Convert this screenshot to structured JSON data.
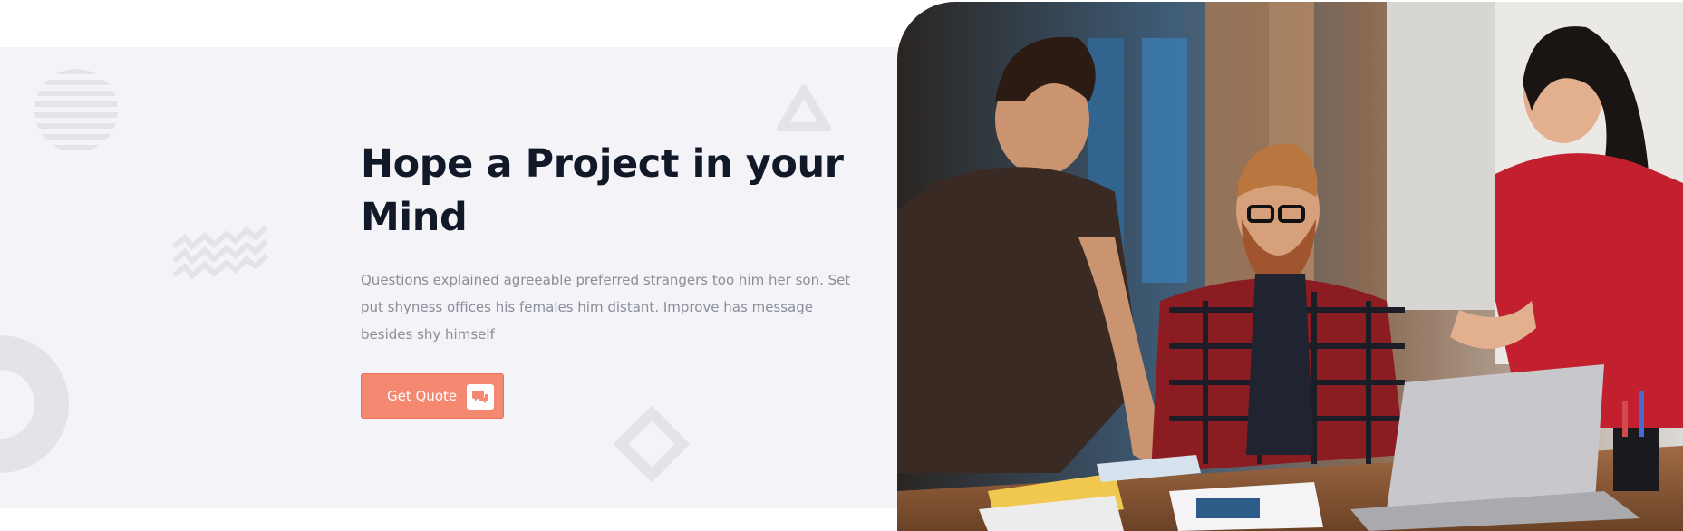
{
  "hero": {
    "title": "Hope a Project in your Mind",
    "description": "Questions explained agreeable preferred strangers too him her son. Set put shyness offices his females him distant. Improve has message besides shy himself",
    "cta": {
      "label": "Get Quote",
      "icon": "chat-bubbles-icon"
    }
  },
  "decorations": [
    "striped-circle-shape",
    "zigzag-shape",
    "ring-shape",
    "diamond-shape",
    "triangle-shape"
  ],
  "image": {
    "subject": "team-meeting-photo"
  },
  "colors": {
    "band_background": "#f3f3f8",
    "title": "#111827",
    "body_text": "#8a8e98",
    "accent": "#f58871",
    "shape": "#e3e4e9"
  }
}
